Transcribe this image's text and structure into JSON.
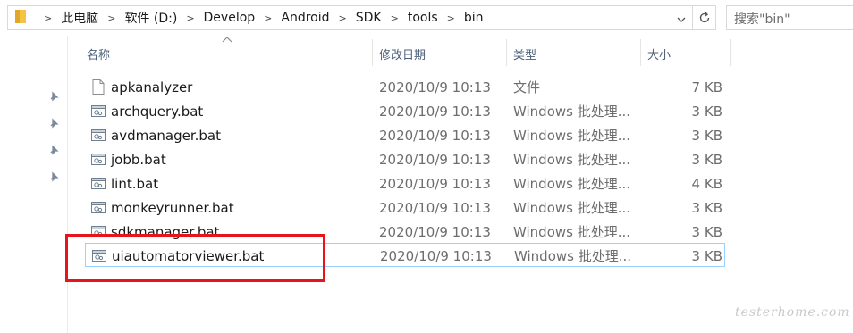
{
  "address_bar": {
    "breadcrumbs": [
      "此电脑",
      "软件 (D:)",
      "Develop",
      "Android",
      "SDK",
      "tools",
      "bin"
    ]
  },
  "search": {
    "placeholder": "搜索\"bin\""
  },
  "columns": {
    "name": "名称",
    "date": "修改日期",
    "type": "类型",
    "size": "大小"
  },
  "files": [
    {
      "name": "apkanalyzer",
      "date": "2020/10/9 10:13",
      "type": "文件",
      "size": "7 KB",
      "icon": "file-icon"
    },
    {
      "name": "archquery.bat",
      "date": "2020/10/9 10:13",
      "type": "Windows 批处理...",
      "size": "3 KB",
      "icon": "batch-file-icon"
    },
    {
      "name": "avdmanager.bat",
      "date": "2020/10/9 10:13",
      "type": "Windows 批处理...",
      "size": "3 KB",
      "icon": "batch-file-icon"
    },
    {
      "name": "jobb.bat",
      "date": "2020/10/9 10:13",
      "type": "Windows 批处理...",
      "size": "3 KB",
      "icon": "batch-file-icon"
    },
    {
      "name": "lint.bat",
      "date": "2020/10/9 10:13",
      "type": "Windows 批处理...",
      "size": "4 KB",
      "icon": "batch-file-icon"
    },
    {
      "name": "monkeyrunner.bat",
      "date": "2020/10/9 10:13",
      "type": "Windows 批处理...",
      "size": "3 KB",
      "icon": "batch-file-icon"
    },
    {
      "name": "sdkmanager.bat",
      "date": "2020/10/9 10:13",
      "type": "Windows 批处理...",
      "size": "3 KB",
      "icon": "batch-file-icon"
    },
    {
      "name": "uiautomatorviewer.bat",
      "date": "2020/10/9 10:13",
      "type": "Windows 批处理...",
      "size": "3 KB",
      "icon": "batch-file-icon",
      "selected": true
    }
  ],
  "watermark": "testerhome.com",
  "colors": {
    "selection_border": "#99d1ff",
    "annotation_red": "#e8141b",
    "header_text": "#4c607a"
  }
}
